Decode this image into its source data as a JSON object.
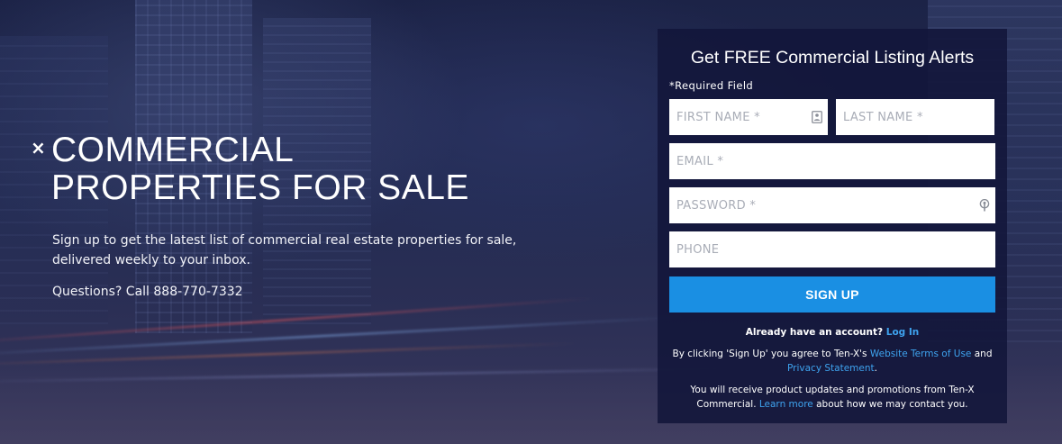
{
  "hero": {
    "close_glyph": "×",
    "title_line1": "COMMERCIAL",
    "title_line2": "PROPERTIES FOR SALE",
    "description": "Sign up to get the latest list of commercial real estate properties for sale, delivered weekly to your inbox.",
    "questions": "Questions? Call 888-770-7332"
  },
  "form": {
    "title": "Get FREE Commercial Listing Alerts",
    "required_note": "*Required Field",
    "fields": {
      "first_name": {
        "placeholder": "FIRST NAME *",
        "value": ""
      },
      "last_name": {
        "placeholder": "LAST NAME *",
        "value": ""
      },
      "email": {
        "placeholder": "EMAIL *",
        "value": ""
      },
      "password": {
        "placeholder": "PASSWORD *",
        "value": ""
      },
      "phone": {
        "placeholder": "PHONE",
        "value": ""
      }
    },
    "submit_label": "SIGN UP",
    "already_text": "Already have an account?",
    "login_link": "Log In",
    "terms_prefix": "By clicking 'Sign Up' you agree to Ten-X's",
    "terms_link": "Website Terms of Use",
    "terms_and": "and",
    "privacy_link": "Privacy Statement",
    "terms_suffix": ".",
    "promo_prefix": "You will receive product updates and promotions from Ten-X Commercial.",
    "learn_more_link": "Learn more",
    "promo_suffix": "about how we may contact you."
  },
  "colors": {
    "accent": "#1a8fe3",
    "link": "#3ea3ef",
    "card_bg": "#12163a"
  },
  "icons": {
    "contact_card": "contact-card-icon",
    "password_key": "password-key-icon"
  }
}
